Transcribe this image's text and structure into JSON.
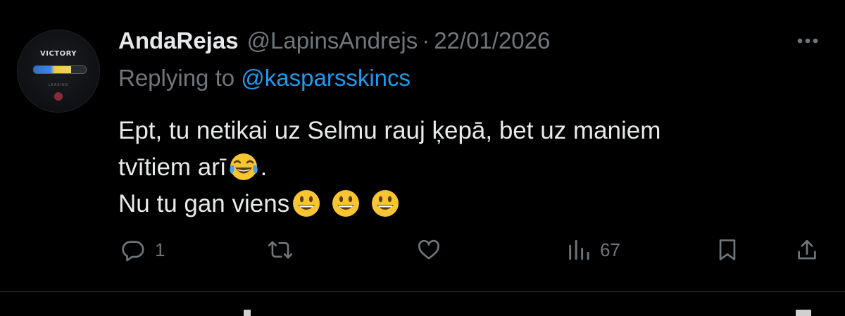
{
  "tweet": {
    "avatar": {
      "logo_text": "VICTORY",
      "sub_text": "LEASING",
      "bar_fill_fraction": 0.72,
      "colors": {
        "blue": "#3b86e6",
        "yellow": "#f2d65a"
      }
    },
    "display_name": "AndaRejas",
    "handle": "@LapinsAndrejs",
    "separator": "·",
    "date": "22/01/2026",
    "reply_prefix": "Replying to",
    "reply_mention": "@kasparsskincs",
    "body": {
      "line1": "Ept, tu netikai uz Selmu rauj ķepā, bet uz maniem",
      "line2_text": "tvītiem arī",
      "line2_emoji": "tears-of-joy-emoji",
      "line2_end": ".",
      "line3_text": "Nu tu gan viens",
      "line3_emojis": [
        "grinning-face-emoji",
        "grinning-face-emoji",
        "grinning-face-emoji"
      ]
    },
    "actions": {
      "reply": {
        "icon": "reply-icon",
        "count": "1"
      },
      "retweet": {
        "icon": "retweet-icon",
        "count": ""
      },
      "like": {
        "icon": "heart-icon",
        "count": ""
      },
      "views": {
        "icon": "views-icon",
        "count": "67"
      },
      "bookmark": {
        "icon": "bookmark-icon"
      },
      "share": {
        "icon": "share-icon"
      }
    }
  },
  "colors": {
    "background": "#000000",
    "text": "#e7e9ea",
    "muted": "#71767b",
    "link": "#1d9bf0",
    "divider": "#2f3336"
  }
}
